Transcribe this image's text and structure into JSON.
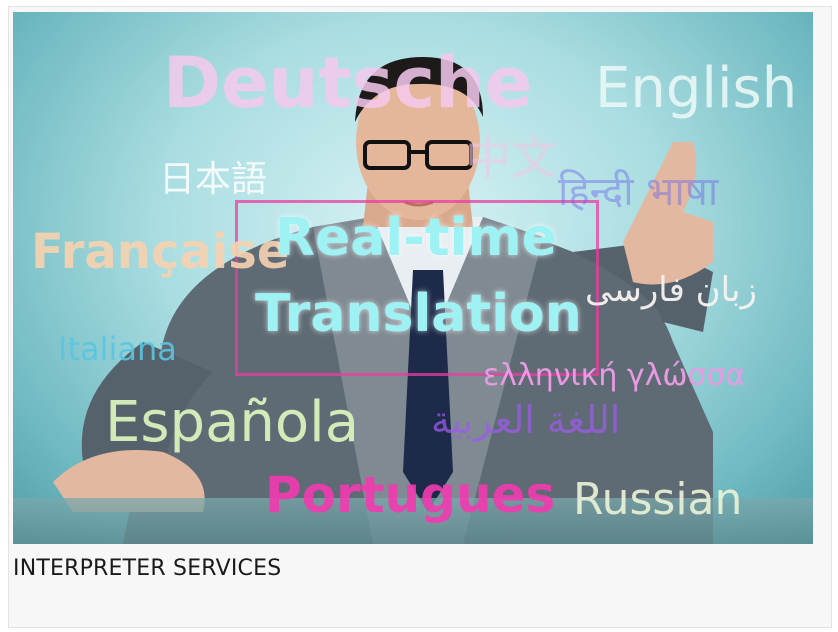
{
  "hero": {
    "headline_line1": "Real-time",
    "headline_line2": "Translation",
    "languages": {
      "deutsche": "Deutsche",
      "english": "English",
      "japanese": "日本語",
      "chinese": "中文",
      "hindi": "हिन्दी भाषा",
      "francaise": "Française",
      "persian": "زبان فارسی",
      "italiana": "Italiana",
      "greek": "ελληνική γλώσσα",
      "espanola": "Española",
      "arabic": "اللغة العربية",
      "portugues": "Portugues",
      "russian": "Russian"
    }
  },
  "caption": "INTERPRETER SERVICES"
}
